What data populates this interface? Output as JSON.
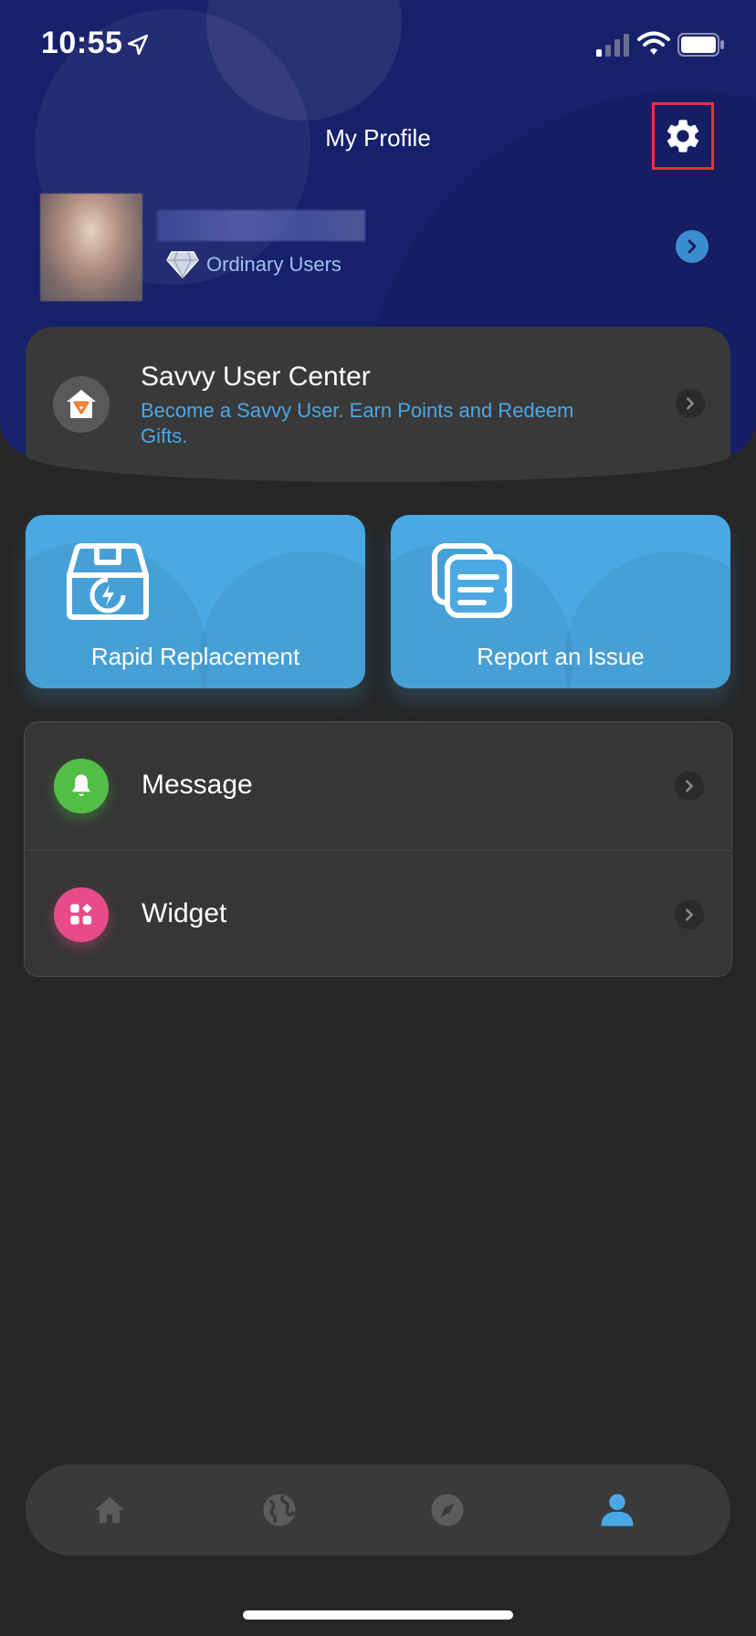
{
  "status_bar": {
    "time": "10:55",
    "icons": [
      "location-arrow-icon",
      "cellular-signal-icon",
      "wifi-icon",
      "battery-icon"
    ]
  },
  "header": {
    "title": "My Profile",
    "settings_icon": "gear-icon"
  },
  "profile": {
    "level_label": "Ordinary Users",
    "level_icon": "diamond-icon"
  },
  "savvy_center": {
    "title": "Savvy User Center",
    "subtitle": "Become a Savvy User. Earn Points and Redeem Gifts.",
    "icon": "house-shield-icon"
  },
  "actions": [
    {
      "label": "Rapid Replacement",
      "icon": "box-lightning-icon"
    },
    {
      "label": "Report an Issue",
      "icon": "documents-icon"
    }
  ],
  "menu": [
    {
      "label": "Message",
      "icon": "bell-icon",
      "color": "#52be45"
    },
    {
      "label": "Widget",
      "icon": "widget-grid-icon",
      "color": "#e84b8a"
    }
  ],
  "bottom_nav": {
    "items": [
      {
        "name": "home",
        "icon": "home-icon",
        "active": false
      },
      {
        "name": "globe",
        "icon": "globe-icon",
        "active": false
      },
      {
        "name": "explore",
        "icon": "compass-icon",
        "active": false
      },
      {
        "name": "profile",
        "icon": "person-icon",
        "active": true
      }
    ],
    "active_color": "#4aa8e6",
    "inactive_color": "#5c5c5c"
  },
  "colors": {
    "header_bg": "#17206a",
    "accent_blue": "#4aa8e6",
    "settings_highlight": "#e5323c",
    "page_bg": "#262626"
  }
}
